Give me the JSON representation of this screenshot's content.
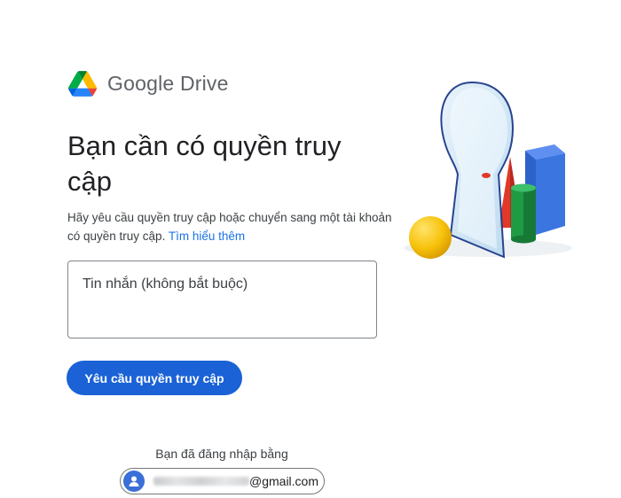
{
  "brand": {
    "name": "Google Drive",
    "logo_icon": "google-drive-logo-icon"
  },
  "main": {
    "title": "Bạn cần có quyền truy cập",
    "description": "Hãy yêu cầu quyền truy cập hoặc chuyển sang một tài khoản có quyền truy cập.",
    "learn_more_link": "Tìm hiểu thêm",
    "message_placeholder": "Tin nhắn (không bắt buộc)",
    "message_value": "",
    "request_button": "Yêu cầu quyền truy cập"
  },
  "account": {
    "signed_in_label": "Bạn đã đăng nhập bằng",
    "email_domain": "@gmail.com",
    "avatar_icon": "person-icon"
  },
  "colors": {
    "primary_button": "#1a62d6",
    "link": "#1a73e8",
    "drive_green": "#0f9d58",
    "drive_yellow": "#ffba00",
    "drive_blue": "#4285f4"
  }
}
